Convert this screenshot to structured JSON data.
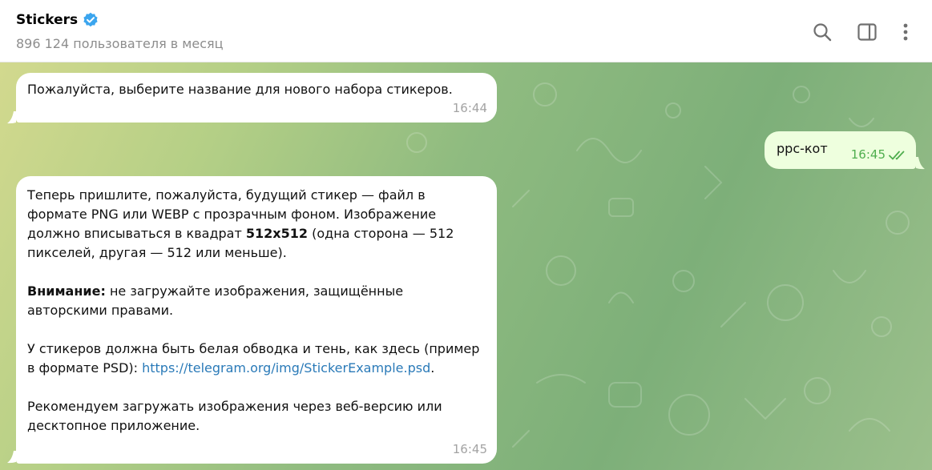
{
  "header": {
    "title": "Stickers",
    "subtitle": "896 124 пользователя в месяц",
    "icons": [
      "search-icon",
      "sidebar-toggle-icon",
      "more-vertical-icon"
    ]
  },
  "messages": {
    "first": {
      "text": "Пожалуйста, выберите название для нового набора стикеров.",
      "time": "16:44"
    },
    "outgoing": {
      "text": "ррс-кот",
      "time": "16:45"
    },
    "second": {
      "p1_start": "Теперь пришлите, пожалуйста, будущий стикер — файл в формате PNG или WEBP с прозрачным фоном. Изображение должно вписываться в квадрат ",
      "p1_bold": "512x512",
      "p1_end": " (одна сторона — 512 пикселей, другая — 512 или меньше).",
      "p2_bold": "Внимание:",
      "p2_text": " не загружайте изображения, защищённые авторскими правами.",
      "p3_text": "У стикеров должна быть белая обводка и тень, как здесь (пример в формате PSD): ",
      "p3_link": "https://telegram.org/img/StickerExample.psd",
      "p3_end": ".",
      "p4_text": "Рекомендуем загружать изображения через веб-версию или десктопное приложение.",
      "time": "16:45"
    }
  },
  "colors": {
    "verified": "#3ba5ee",
    "link": "#2a7ab8",
    "outgoing_bubble": "#eeffde",
    "outgoing_time": "#4fae4e"
  }
}
